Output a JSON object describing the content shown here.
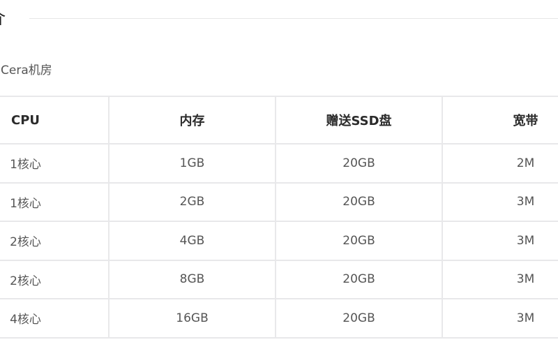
{
  "heading": {
    "text": "介"
  },
  "intro": {
    "text": "Cera机房"
  },
  "table": {
    "headers": [
      "CPU",
      "内存",
      "赠送SSD盘",
      "宽带"
    ],
    "rows": [
      [
        "1核心",
        "1GB",
        "20GB",
        "2M"
      ],
      [
        "1核心",
        "2GB",
        "20GB",
        "3M"
      ],
      [
        "2核心",
        "4GB",
        "20GB",
        "3M"
      ],
      [
        "2核心",
        "8GB",
        "20GB",
        "3M"
      ],
      [
        "4核心",
        "16GB",
        "20GB",
        "3M"
      ]
    ]
  }
}
